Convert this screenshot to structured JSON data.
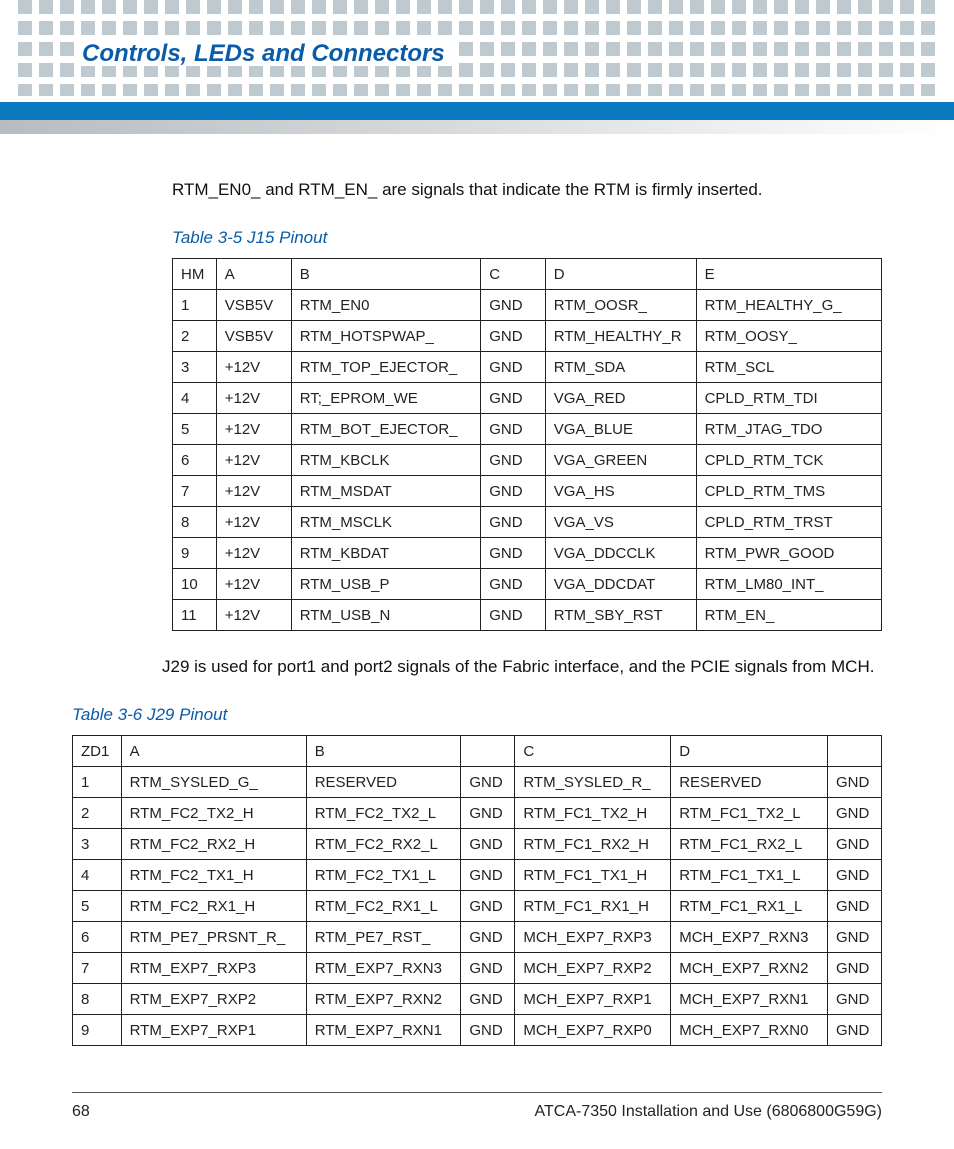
{
  "header": {
    "title": "Controls, LEDs and Connectors"
  },
  "intro1": "RTM_EN0_ and RTM_EN_ are signals that indicate the RTM is firmly inserted.",
  "table1": {
    "caption": "Table 3-5 J15 Pinout",
    "headers": [
      "HM",
      "A",
      "B",
      "C",
      "D",
      "E"
    ],
    "rows": [
      [
        "1",
        "VSB5V",
        "RTM_EN0",
        "GND",
        "RTM_OOSR_",
        "RTM_HEALTHY_G_"
      ],
      [
        "2",
        "VSB5V",
        "RTM_HOTSPWAP_",
        "GND",
        "RTM_HEALTHY_R",
        "RTM_OOSY_"
      ],
      [
        "3",
        "+12V",
        "RTM_TOP_EJECTOR_",
        "GND",
        "RTM_SDA",
        "RTM_SCL"
      ],
      [
        "4",
        "+12V",
        "RT;_EPROM_WE",
        "GND",
        "VGA_RED",
        "CPLD_RTM_TDI"
      ],
      [
        "5",
        "+12V",
        "RTM_BOT_EJECTOR_",
        "GND",
        "VGA_BLUE",
        "RTM_JTAG_TDO"
      ],
      [
        "6",
        "+12V",
        "RTM_KBCLK",
        "GND",
        "VGA_GREEN",
        "CPLD_RTM_TCK"
      ],
      [
        "7",
        "+12V",
        "RTM_MSDAT",
        "GND",
        "VGA_HS",
        "CPLD_RTM_TMS"
      ],
      [
        "8",
        "+12V",
        "RTM_MSCLK",
        "GND",
        "VGA_VS",
        "CPLD_RTM_TRST"
      ],
      [
        "9",
        "+12V",
        "RTM_KBDAT",
        "GND",
        "VGA_DDCCLK",
        "RTM_PWR_GOOD"
      ],
      [
        "10",
        "+12V",
        "RTM_USB_P",
        "GND",
        "VGA_DDCDAT",
        "RTM_LM80_INT_"
      ],
      [
        "11",
        "+12V",
        "RTM_USB_N",
        "GND",
        "RTM_SBY_RST",
        "RTM_EN_"
      ]
    ]
  },
  "intro2": "J29 is used for port1 and port2 signals of the Fabric interface, and the PCIE signals from MCH.",
  "table2": {
    "caption": "Table 3-6 J29 Pinout",
    "headers": [
      "ZD1",
      "A",
      "B",
      "",
      "C",
      "D",
      ""
    ],
    "rows": [
      [
        "1",
        "RTM_SYSLED_G_",
        "RESERVED",
        "GND",
        "RTM_SYSLED_R_",
        "RESERVED",
        "GND"
      ],
      [
        "2",
        "RTM_FC2_TX2_H",
        "RTM_FC2_TX2_L",
        "GND",
        "RTM_FC1_TX2_H",
        "RTM_FC1_TX2_L",
        "GND"
      ],
      [
        "3",
        "RTM_FC2_RX2_H",
        "RTM_FC2_RX2_L",
        "GND",
        "RTM_FC1_RX2_H",
        "RTM_FC1_RX2_L",
        "GND"
      ],
      [
        "4",
        "RTM_FC2_TX1_H",
        "RTM_FC2_TX1_L",
        "GND",
        "RTM_FC1_TX1_H",
        "RTM_FC1_TX1_L",
        "GND"
      ],
      [
        "5",
        "RTM_FC2_RX1_H",
        "RTM_FC2_RX1_L",
        "GND",
        "RTM_FC1_RX1_H",
        "RTM_FC1_RX1_L",
        "GND"
      ],
      [
        "6",
        "RTM_PE7_PRSNT_R_",
        "RTM_PE7_RST_",
        "GND",
        "MCH_EXP7_RXP3",
        "MCH_EXP7_RXN3",
        "GND"
      ],
      [
        "7",
        "RTM_EXP7_RXP3",
        "RTM_EXP7_RXN3",
        "GND",
        "MCH_EXP7_RXP2",
        "MCH_EXP7_RXN2",
        "GND"
      ],
      [
        "8",
        "RTM_EXP7_RXP2",
        "RTM_EXP7_RXN2",
        "GND",
        "MCH_EXP7_RXP1",
        "MCH_EXP7_RXN1",
        "GND"
      ],
      [
        "9",
        "RTM_EXP7_RXP1",
        "RTM_EXP7_RXN1",
        "GND",
        "MCH_EXP7_RXP0",
        "MCH_EXP7_RXN0",
        "GND"
      ]
    ]
  },
  "footer": {
    "page": "68",
    "doc": "ATCA-7350 Installation and Use (6806800G59G)"
  }
}
